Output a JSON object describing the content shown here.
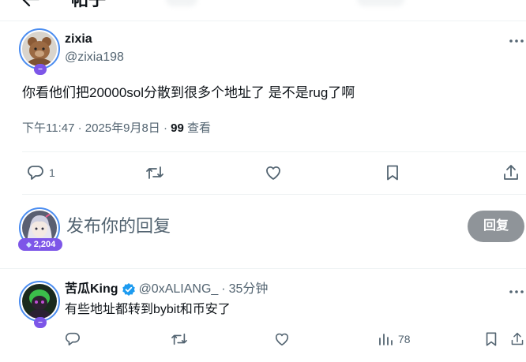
{
  "header": {
    "title": "帖子"
  },
  "post": {
    "author_name": "zixia",
    "author_handle": "@zixia198",
    "avatar_badge": "–",
    "text": "你看他们把20000sol分散到很多个地址了 是不是rug了啊",
    "time": "下午11:47 · 2025年9月8日 · ",
    "views_count": "99",
    "views_label": " 查看",
    "reply_count": "1",
    "icons": {
      "reply": "reply-icon",
      "repost": "repost-icon",
      "like": "heart-icon",
      "bookmark": "bookmark-icon",
      "share": "share-icon",
      "more": "more-icon"
    }
  },
  "compose": {
    "placeholder": "发布你的回复",
    "badge_count": "2,204",
    "reply_button": "回复"
  },
  "reply": {
    "author_name": "苦瓜King",
    "author_handle": "@0xALIANG_",
    "separator": "·",
    "time": "35分钟",
    "avatar_badge": "–",
    "text": "有些地址都转到bybit和币安了",
    "views_count": "78"
  },
  "colors": {
    "accent": "#1d9bf0",
    "badge": "#7d56e8",
    "ring": "#4a8cf0",
    "muted": "#536471",
    "button": "#8f9499"
  }
}
